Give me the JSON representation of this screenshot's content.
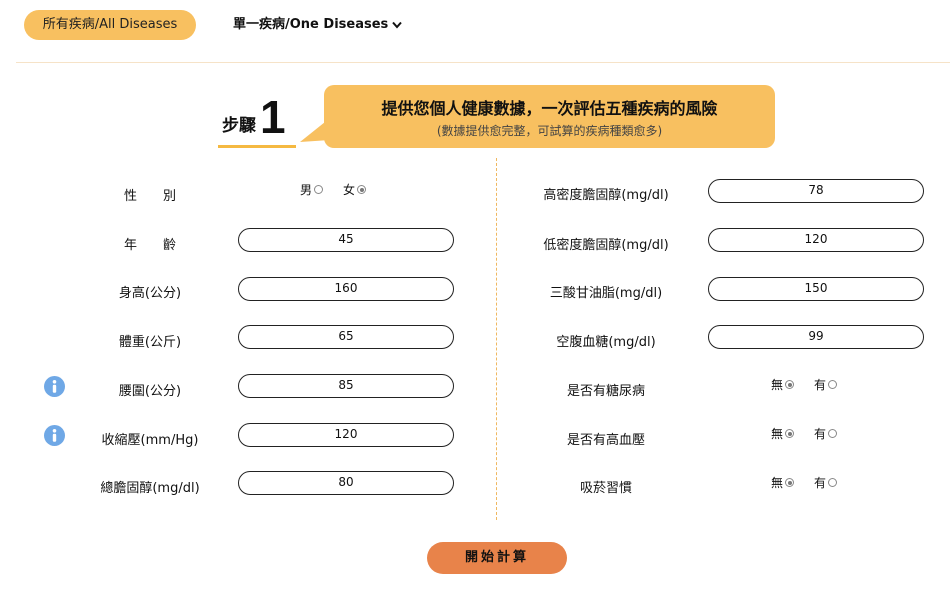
{
  "tabs": {
    "all_diseases": "所有疾病/All Diseases",
    "one_disease": "單一疾病/One Diseases"
  },
  "step": {
    "label": "步驟",
    "number": "1"
  },
  "banner": {
    "title": "提供您個人健康數據，一次評估五種疾病的風險",
    "subtitle": "(數據提供愈完整，可試算的疾病種類愈多)"
  },
  "left_form": {
    "gender": {
      "label": "性　　別",
      "options": [
        "男",
        "女"
      ],
      "selected": "女"
    },
    "age": {
      "label": "年　　齡",
      "value": "45"
    },
    "height": {
      "label": "身高(公分)",
      "value": "160"
    },
    "weight": {
      "label": "體重(公斤)",
      "value": "65"
    },
    "waist": {
      "label": "腰圍(公分)",
      "value": "85"
    },
    "systolic": {
      "label": "收縮壓(mm/Hg)",
      "value": "120"
    },
    "cholesterol": {
      "label": "總膽固醇(mg/dl)",
      "value": "80"
    }
  },
  "right_form": {
    "hdl": {
      "label": "高密度膽固醇(mg/dl)",
      "value": "78"
    },
    "ldl": {
      "label": "低密度膽固醇(mg/dl)",
      "value": "120"
    },
    "triglyceride": {
      "label": "三酸甘油脂(mg/dl)",
      "value": "150"
    },
    "glucose": {
      "label": "空腹血糖(mg/dl)",
      "value": "99"
    },
    "diabetes": {
      "label": "是否有糖尿病",
      "options": [
        "無",
        "有"
      ],
      "selected": "無"
    },
    "hypertension": {
      "label": "是否有高血壓",
      "options": [
        "無",
        "有"
      ],
      "selected": "無"
    },
    "smoking": {
      "label": "吸菸習慣",
      "options": [
        "無",
        "有"
      ],
      "selected": "無"
    }
  },
  "calculate_button": "開始計算",
  "colors": {
    "tab_active": "#f8c060",
    "banner": "#f8c060",
    "accent_line": "#f5b941",
    "button": "#e8834a",
    "info_icon": "#6fa8e6"
  }
}
